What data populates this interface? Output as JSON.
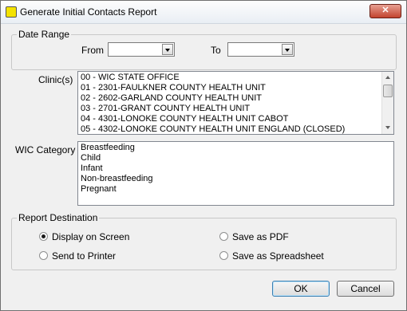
{
  "window": {
    "title": "Generate Initial Contacts Report",
    "close_label": "✕"
  },
  "date_range": {
    "legend": "Date Range",
    "from_label": "From",
    "from_value": "",
    "to_label": "To",
    "to_value": ""
  },
  "clinics": {
    "label": "Clinic(s)",
    "items": [
      "00 - WIC  STATE OFFICE",
      "01 - 2301-FAULKNER COUNTY HEALTH UNIT",
      "02 - 2602-GARLAND COUNTY HEALTH UNIT",
      "03 - 2701-GRANT COUNTY HEALTH UNIT",
      "04 - 4301-LONOKE COUNTY HEALTH UNIT CABOT",
      "05 - 4302-LONOKE COUNTY HEALTH UNIT ENGLAND (CLOSED)"
    ]
  },
  "wic_category": {
    "label": "WIC Category",
    "items": [
      "Breastfeeding",
      "Child",
      "Infant",
      "Non-breastfeeding",
      "Pregnant"
    ]
  },
  "report_destination": {
    "legend": "Report Destination",
    "options": [
      {
        "label": "Display on Screen",
        "selected": true
      },
      {
        "label": "Send to Printer",
        "selected": false
      },
      {
        "label": "Save as PDF",
        "selected": false
      },
      {
        "label": "Save as Spreadsheet",
        "selected": false
      }
    ]
  },
  "buttons": {
    "ok": "OK",
    "cancel": "Cancel"
  },
  "colors": {
    "window_bg": "#f0f0f0",
    "close_button": "#c2432e",
    "app_icon": "#f4e200"
  }
}
